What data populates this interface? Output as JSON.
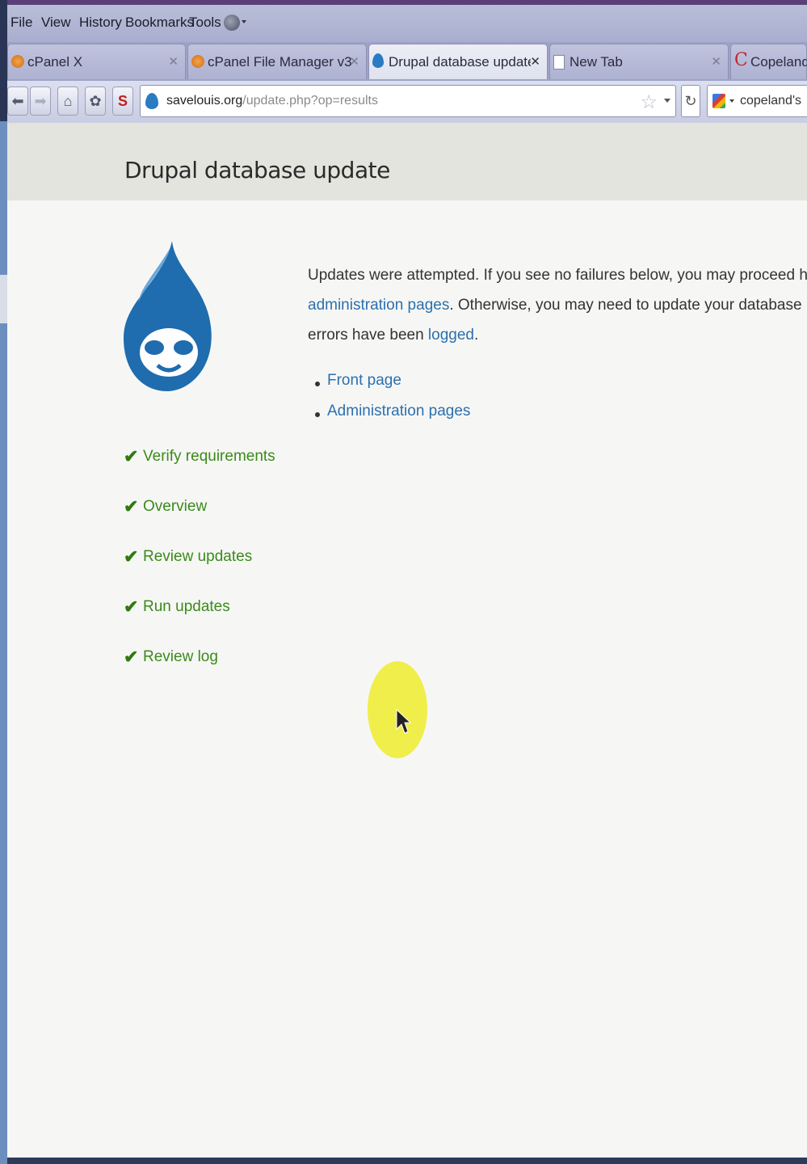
{
  "menu": [
    "File",
    "View",
    "History",
    "Bookmarks",
    "Tools"
  ],
  "tabs": [
    {
      "label": "cPanel X",
      "icon": "cpanel-icon",
      "active": false
    },
    {
      "label": "cPanel File Manager v3",
      "icon": "cpanel-icon",
      "active": false
    },
    {
      "label": "Drupal database update | ...",
      "icon": "drupal-drop-icon",
      "active": true
    },
    {
      "label": "New Tab",
      "icon": "blank-page-icon",
      "active": false
    },
    {
      "label": "Copeland's",
      "icon": "copeland-c-icon",
      "active": false
    }
  ],
  "address": {
    "domain": "savelouis.org",
    "path": "/update.php?op=results"
  },
  "search": {
    "value": "copeland's"
  },
  "page": {
    "title": "Drupal database update",
    "message": {
      "part1": "Updates were attempted. If you see no failures below, you may proceed happily to the",
      "link1": "administration pages",
      "part2": ". Otherwise, you may need to update your database manually. All",
      "part3": "errors have been ",
      "link2": "logged",
      "part4": "."
    },
    "links": [
      "Front page",
      "Administration pages"
    ],
    "steps": [
      "Verify requirements",
      "Overview",
      "Review updates",
      "Run updates",
      "Review log"
    ]
  },
  "colors": {
    "link": "#2c6fb0",
    "step_done": "#3b8a1a",
    "drupal_blue": "#1f6cae"
  }
}
